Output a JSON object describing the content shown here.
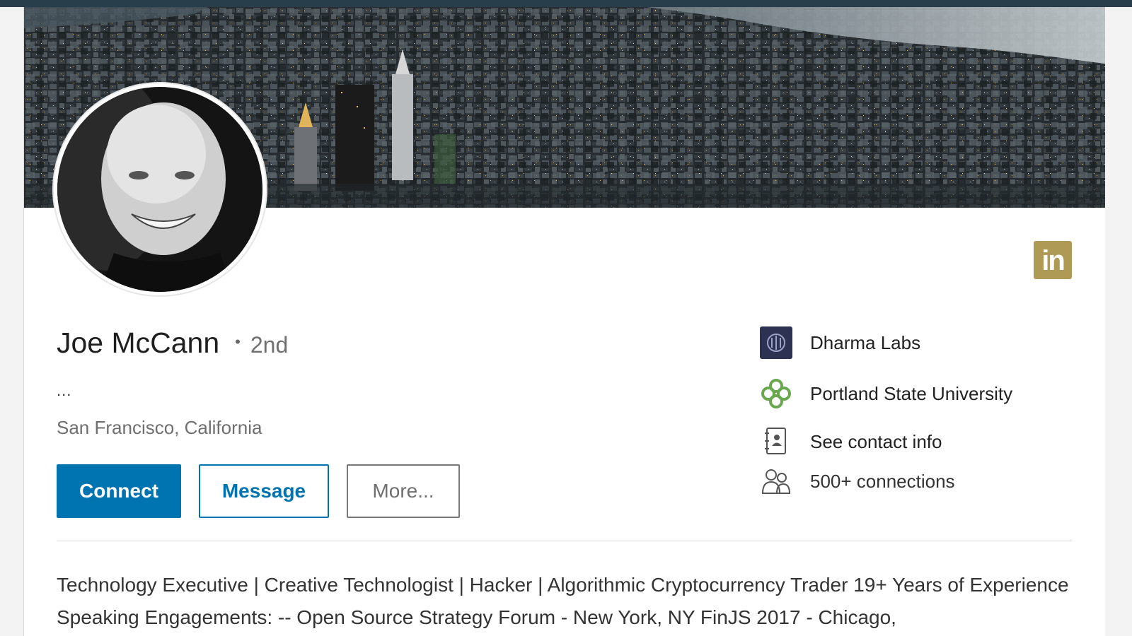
{
  "profile": {
    "name": "Joe McCann",
    "separator": "•",
    "degree": "2nd",
    "headline": "...",
    "location": "San Francisco, California",
    "summary": "Technology Executive | Creative Technologist | Hacker | Algorithmic Cryptocurrency Trader 19+ Years of Experience Speaking Engagements: -- Open Source Strategy Forum - New York, NY FinJS 2017 - Chicago,"
  },
  "actions": {
    "connect": "Connect",
    "message": "Message",
    "more": "More..."
  },
  "badge": {
    "text": "in",
    "icon": "linkedin-icon",
    "color": "#af9a55"
  },
  "sidebar": {
    "company": {
      "label": "Dharma Labs",
      "icon": "company-logo-icon"
    },
    "school": {
      "label": "Portland State University",
      "icon": "university-logo-icon"
    },
    "contact": {
      "label": "See contact info",
      "icon": "address-book-icon"
    },
    "connections": {
      "label": "500+ connections",
      "icon": "people-icon"
    }
  },
  "colors": {
    "primary": "#0073b1",
    "topbar": "#283e4a",
    "badge": "#af9a55",
    "school_logo": "#6aa84f",
    "company_logo": "#2d3152"
  }
}
